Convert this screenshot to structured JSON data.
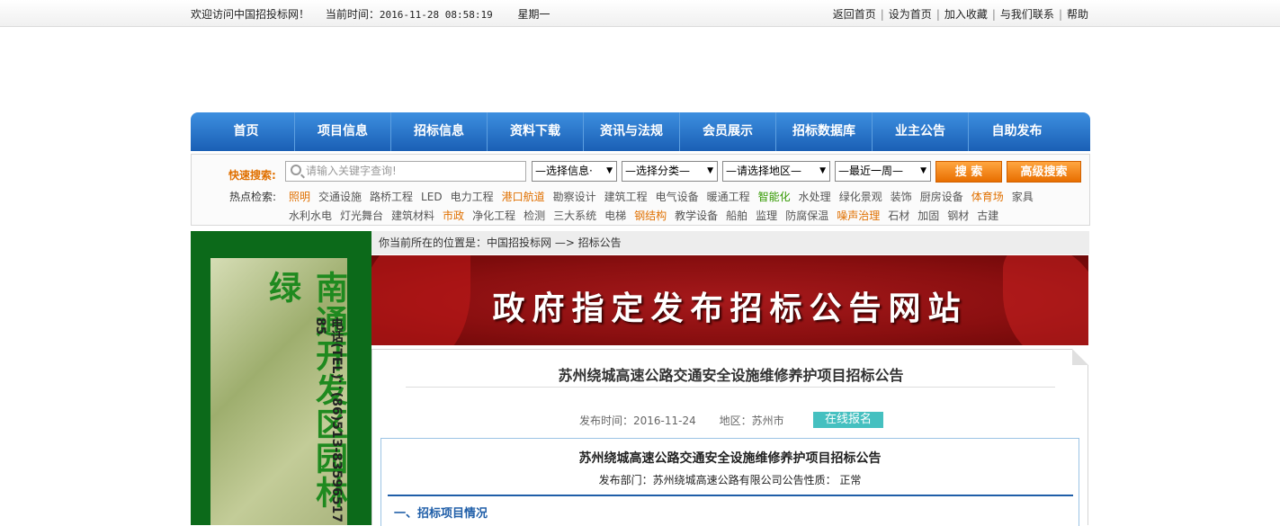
{
  "topbar": {
    "welcome": "欢迎访问中国招投标网！",
    "time_label": "当前时间：",
    "time_value": "2016-11-28 08:58:19",
    "weekday": "星期一",
    "links": [
      "返回首页",
      "设为首页",
      "加入收藏",
      "与我们联系",
      "帮助"
    ]
  },
  "nav": {
    "items": [
      "首页",
      "项目信息",
      "招标信息",
      "资料下载",
      "资讯与法规",
      "会员展示",
      "招标数据库",
      "业主公告",
      "自助发布"
    ]
  },
  "search": {
    "label": "快速搜索:",
    "placeholder": "请输入关键字查询!",
    "selects": [
      "—选择信息·",
      "—选择分类—",
      "—请选择地区—",
      "—最近一周—"
    ],
    "search_button": "搜 索",
    "advanced_button": "高级搜索",
    "hot_label": "热点检索:",
    "hot_row1": [
      {
        "t": "照明",
        "c": "hl"
      },
      {
        "t": "交通设施",
        "c": ""
      },
      {
        "t": "路桥工程",
        "c": ""
      },
      {
        "t": "LED",
        "c": ""
      },
      {
        "t": "电力工程",
        "c": ""
      },
      {
        "t": "港口航道",
        "c": "hl"
      },
      {
        "t": "勘察设计",
        "c": ""
      },
      {
        "t": "建筑工程",
        "c": ""
      },
      {
        "t": "电气设备",
        "c": ""
      },
      {
        "t": "暖通工程",
        "c": ""
      },
      {
        "t": "智能化",
        "c": "gr"
      },
      {
        "t": "水处理",
        "c": ""
      },
      {
        "t": "绿化景观",
        "c": ""
      },
      {
        "t": "装饰",
        "c": ""
      },
      {
        "t": "厨房设备",
        "c": ""
      },
      {
        "t": "体育场",
        "c": "hl"
      },
      {
        "t": "家具",
        "c": ""
      }
    ],
    "hot_row2": [
      {
        "t": "水利水电",
        "c": ""
      },
      {
        "t": "灯光舞台",
        "c": ""
      },
      {
        "t": "建筑材料",
        "c": ""
      },
      {
        "t": "市政",
        "c": "hl"
      },
      {
        "t": "净化工程",
        "c": ""
      },
      {
        "t": "检测",
        "c": ""
      },
      {
        "t": "三大系统",
        "c": ""
      },
      {
        "t": "电梯",
        "c": ""
      },
      {
        "t": "钢结构",
        "c": "hl"
      },
      {
        "t": "教学设备",
        "c": ""
      },
      {
        "t": "船舶",
        "c": ""
      },
      {
        "t": "监理",
        "c": ""
      },
      {
        "t": "防腐保温",
        "c": ""
      },
      {
        "t": "噪声治理",
        "c": "hl"
      },
      {
        "t": "石材",
        "c": ""
      },
      {
        "t": "加固",
        "c": ""
      },
      {
        "t": "钢材",
        "c": ""
      },
      {
        "t": "古建",
        "c": ""
      }
    ]
  },
  "left_ad": {
    "title": "南通开发区园林绿",
    "tel": "电话(TEL)：(86)513-83596517 85"
  },
  "breadcrumb": "你当前所在的位置是：中国招投标网 —> 招标公告",
  "banner_text": "政府指定发布招标公告网站",
  "article": {
    "title": "苏州绕城高速公路交通安全设施维修养护项目招标公告",
    "date_label": "发布时间：",
    "date": "2016-11-24",
    "region_label": "地区：",
    "region": "苏州市",
    "apply_button": "在线报名",
    "box_title": "苏州绕城高速公路交通安全设施维修养护项目招标公告",
    "box_sub": "发布部门：苏州绕城高速公路有限公司公告性质： 正常",
    "section1": "一、招标项目情况"
  }
}
